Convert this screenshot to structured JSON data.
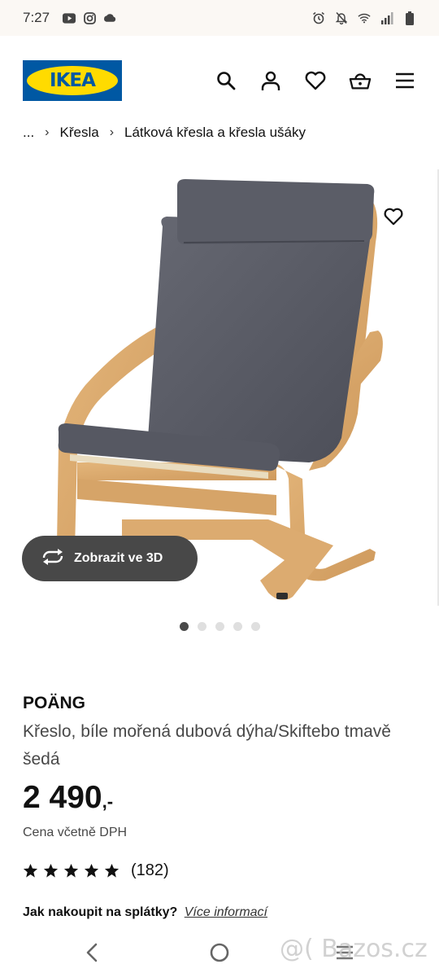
{
  "status_bar": {
    "time": "7:27",
    "left_icons": [
      "youtube-icon",
      "instagram-icon",
      "cloud-icon"
    ],
    "right_icons": [
      "alarm-icon",
      "mute-icon",
      "wifi-icon",
      "signal-icon",
      "battery-icon"
    ]
  },
  "header": {
    "logo_text": "IKEA",
    "icons": [
      "search-icon",
      "user-icon",
      "heart-icon",
      "basket-icon",
      "menu-icon"
    ],
    "brand_colors": {
      "blue": "#0058a3",
      "yellow": "#ffdb00"
    }
  },
  "breadcrumb": {
    "items": [
      "...",
      "Křesla",
      "Látková křesla a křesla ušáky"
    ]
  },
  "gallery": {
    "view_3d_label": "Zobrazit ve 3D",
    "image_count": 5,
    "active_index": 0
  },
  "product": {
    "name": "POÄNG",
    "description": "Křeslo, bíle mořená dubová dýha/Skiftebo tmavě šedá",
    "price": "2 490",
    "price_suffix": ",-",
    "price_note": "Cena včetně DPH",
    "rating": 5,
    "review_count": "(182)"
  },
  "installments": {
    "question": "Jak nakoupit na splátky?",
    "link": "Více informací"
  },
  "watermark": "@( Bazos.cz"
}
